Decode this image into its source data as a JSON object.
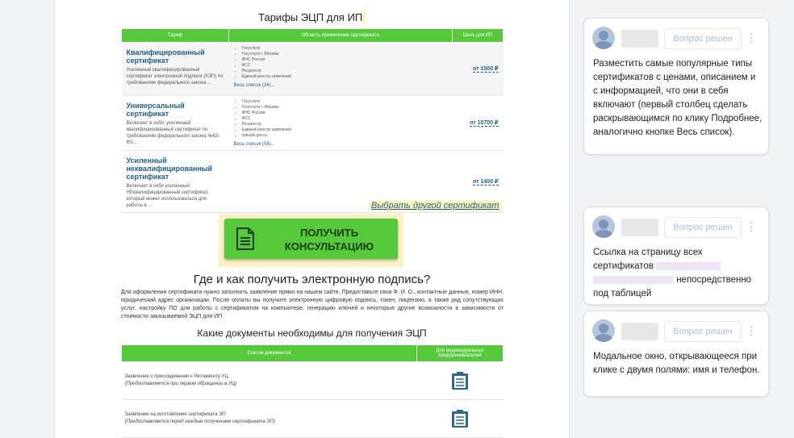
{
  "document": {
    "title": "Тарифы ЭЦП для ИП",
    "tariff_table": {
      "headers": [
        "Тариф",
        "Область применения сертификата",
        "Цена для ИП"
      ],
      "rows": [
        {
          "name": "Квалифицированный сертификат",
          "desc": "Усиленный квалифицированный сертификат электронной подписи (КЭП) по требованиям федерального закона ...",
          "uses": [
            "Госуслуги",
            "Госуслуги г. Москвы",
            "ФНС России",
            "ФСС",
            "Росреестр",
            "Единый реестр заявлений"
          ],
          "more": "Весь список (34)...",
          "price": "от 1500 ₽"
        },
        {
          "name": "Универсальный сертификат",
          "desc": "Включает в себя: усиленный квалифицированный сертификат по требованиям федерального закона №63-ФЗ...",
          "uses": [
            "Госуслуги",
            "Госуслуги г. Москвы",
            "ФНС России",
            "ФСС",
            "Росреестр",
            "Единый реестр заявлений",
            "zakupki.gov.ru"
          ],
          "more": "Весь список (58)...",
          "price": "от 10700 ₽"
        },
        {
          "name": "Усиленный неквалифицированный сертификат",
          "desc": "Включает в себя усиленный НЕквалифицированный сертификат, который может использоваться для работы в ...",
          "uses": [],
          "more": "",
          "price": "от 1400 ₽"
        }
      ]
    },
    "other_cert_link": "Выбрать другой сертификат",
    "cta_button": "ПОЛУЧИТЬ КОНСУЛЬТАЦИЮ",
    "section_title": "Где и как получить электронную подпись?",
    "section_text": "Для оформления сертификата нужно заполнить заявление прямо на нашем сайте. Предоставьте свои Ф. И. О., контактные данные, номер ИНН, юридический адрес организации. После оплаты вы получите электронную цифровую подпись, токен, лицензию, а также ряд сопутствующих услуг: настройку ПО для работы с сертификатом на компьютере, генерацию ключей и некоторые другие возможности в зависимости от стоимости заказываемой ЭЦП для ИП.",
    "docs_title": "Какие документы необходимы для получения ЭЦП",
    "docs_table": {
      "headers": [
        "Список документов",
        "Для индивидуальных предпринимателей"
      ],
      "rows": [
        {
          "text": "Заявление о присоединении к Регламенту УЦ",
          "note": "(Предоставляется при первом обращении в УЦ)"
        },
        {
          "text": "Заявление на изготовление сертификата ЭП",
          "note": "(Предоставляется перед каждым получением сертификата ЭП)"
        }
      ]
    }
  },
  "comments": [
    {
      "resolve_label": "Вопрос решен",
      "text": "Разместить самые популярные типы сертификатов с ценами, описанием и с информацией, что они в себя включают (первый столбец сделать раскрывающимся по клику Подробнее, аналогично кнопке Весь список)."
    },
    {
      "resolve_label": "Вопрос решен",
      "text_start": "Ссылка на страницу всех сертификатов",
      "text_end": "непосредственно под таблицей"
    },
    {
      "resolve_label": "Вопрос решен",
      "text": "Модальное окно, открывающееся при клике с двумя полями: имя и телефон."
    }
  ],
  "colors": {
    "accent_green": "#55c93a",
    "link_blue": "#1f5e8c",
    "resolve_text": "#a9c1e3"
  }
}
